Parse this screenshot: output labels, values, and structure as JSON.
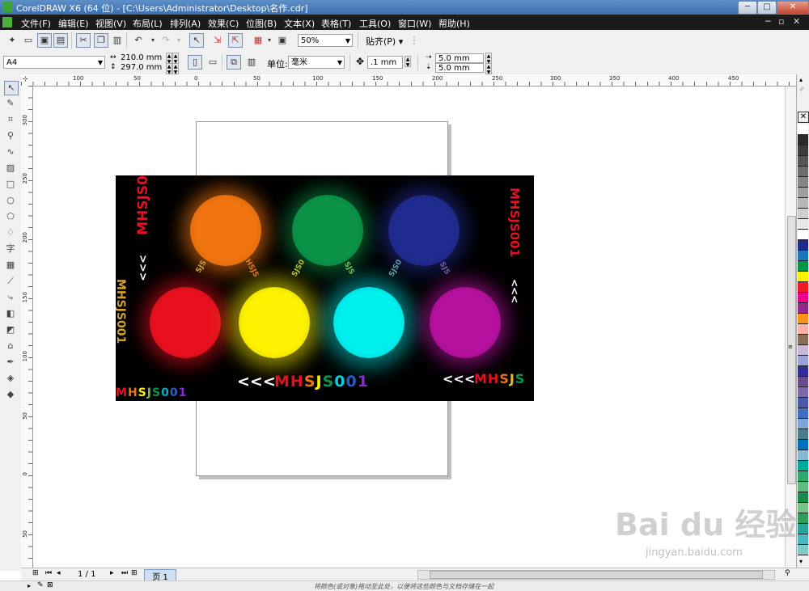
{
  "window": {
    "title": "CorelDRAW X6 (64 位) - [C:\\Users\\Administrator\\Desktop\\名作.cdr]",
    "controls": {
      "minimize": "─",
      "maximize": "□",
      "close": "✕"
    }
  },
  "menu": {
    "items": [
      "文件(F)",
      "编辑(E)",
      "视图(V)",
      "布局(L)",
      "排列(A)",
      "效果(C)",
      "位图(B)",
      "文本(X)",
      "表格(T)",
      "工具(O)",
      "窗口(W)",
      "帮助(H)"
    ],
    "doc_controls": {
      "minimize": "─",
      "restore": "▫",
      "close": "✕"
    }
  },
  "toolbar": {
    "zoom": "50%",
    "snap": "贴齐(P)"
  },
  "propertybar": {
    "paper": "A4",
    "width": "210.0 mm",
    "height": "297.0 mm",
    "units_label": "单位:",
    "units": "毫米",
    "nudge": ".1 mm",
    "dup_x": "5.0 mm",
    "dup_y": "5.0 mm"
  },
  "rulers": {
    "horizontal": [
      "100",
      "50",
      "0",
      "50",
      "100",
      "150",
      "200",
      "250",
      "300",
      "350",
      "400",
      "450"
    ],
    "vertical": [
      "300",
      "250",
      "200",
      "150",
      "100",
      "50",
      "0",
      "50"
    ]
  },
  "artwork": {
    "bottom_text_arrows": "<<<",
    "bottom_text": [
      "M",
      "H",
      "S",
      "J",
      "S",
      "0",
      "0",
      "1"
    ],
    "right_text_arrows": "<<<",
    "right_text": [
      "M",
      "H",
      "S",
      "J",
      "S"
    ],
    "left_bottom_text": [
      "M",
      "H",
      "S",
      "J",
      "S",
      "0",
      "0",
      "1"
    ],
    "vertical_left": "MHSJS0",
    "vertical_left_arrows": "<<<",
    "vertical_right": "MHSJS001",
    "vertical_right_arrows": "<<<",
    "vertical_edge": "MHSJS001",
    "connector_text": [
      "SJS",
      "HSJS",
      "SJS0",
      "SJS",
      "SJS0",
      "SJS"
    ],
    "circles": [
      {
        "color": "#f07410"
      },
      {
        "color": "#0b9347"
      },
      {
        "color": "#1f2b8f"
      },
      {
        "color": "#e8101e"
      },
      {
        "color": "#fff200"
      },
      {
        "color": "#00f0f0"
      },
      {
        "color": "#b5109e"
      }
    ]
  },
  "pages": {
    "counter": "1 / 1",
    "tab": "页 1"
  },
  "status": {
    "message": "将颜色(或对象)拖动至此处，以便将这些颜色与文档存储在一起"
  },
  "watermark": {
    "brand": "Bai du 经验",
    "url": "jingyan.baidu.com"
  },
  "palette": [
    "#ffffff",
    "#2a2a2a",
    "#3d3d3d",
    "#555555",
    "#6d6d6d",
    "#868686",
    "#9e9e9e",
    "#b7b7b7",
    "#cfcfcf",
    "#e7e7e7",
    "#ffffff",
    "#1e2a8c",
    "#1b75bc",
    "#009444",
    "#fff200",
    "#ed1c24",
    "#ec008c",
    "#92278f",
    "#f7941d",
    "#f9b1a8",
    "#8a6e55",
    "#c9b7d8",
    "#9aa4d6",
    "#2e3192",
    "#6a4c8c",
    "#7f6aa8",
    "#4a5aa8",
    "#3c6ebf",
    "#7da7d9",
    "#4a7d8c",
    "#0072bc",
    "#8ab6d6",
    "#00a99d",
    "#2ba86b",
    "#5bbd7f",
    "#1a8a4a",
    "#79c38b",
    "#2f9e5b",
    "#26a69a",
    "#4db6c3",
    "#80cbc4"
  ]
}
